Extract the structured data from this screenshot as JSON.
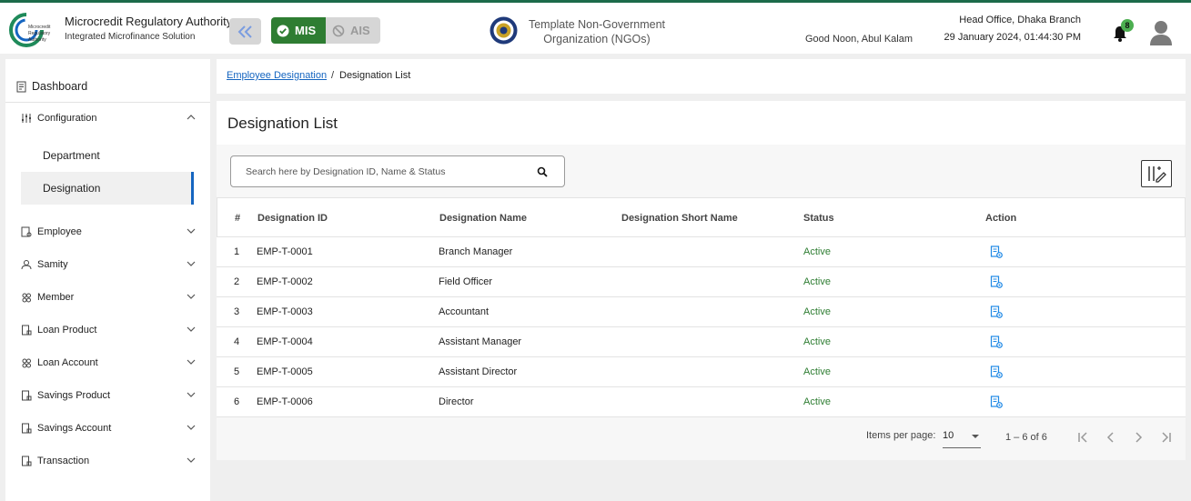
{
  "header": {
    "logo_text": "Microcredit Regulatory Authority",
    "brand_title": "Microcredit Regulatory Authority",
    "brand_subtitle": "Integrated Microfinance Solution",
    "mis_label": "MIS",
    "ais_label": "AIS",
    "org_line1": "Template Non-Government",
    "org_line2": "Organization (NGOs)",
    "greeting": "Good Noon, Abul Kalam",
    "branch": "Head Office, Dhaka Branch",
    "datetime": "29 January 2024, 01:44:30 PM",
    "notification_count": "8",
    "colors": {
      "brand_green": "#2e7d32",
      "accent_blue": "#1565c0"
    }
  },
  "sidebar": {
    "dashboard": "Dashboard",
    "items": [
      {
        "label": "Configuration",
        "icon": "sliders-icon",
        "expanded": true
      },
      {
        "label": "Employee",
        "icon": "employee-icon"
      },
      {
        "label": "Samity",
        "icon": "group-icon"
      },
      {
        "label": "Member",
        "icon": "members-icon"
      },
      {
        "label": "Loan Product",
        "icon": "document-icon"
      },
      {
        "label": "Loan Account",
        "icon": "members-icon"
      },
      {
        "label": "Savings Product",
        "icon": "document-icon"
      },
      {
        "label": "Savings Account",
        "icon": "document-icon"
      },
      {
        "label": "Transaction",
        "icon": "document-icon"
      }
    ],
    "sub_items": [
      {
        "label": "Department"
      },
      {
        "label": "Designation",
        "active": true
      }
    ]
  },
  "breadcrumb": {
    "link": "Employee Designation",
    "separator": "/",
    "current": "Designation List"
  },
  "main": {
    "title": "Designation List",
    "search_placeholder": "Search here by Designation ID, Name & Status"
  },
  "table": {
    "headers": [
      "#",
      "Designation ID",
      "Designation Name",
      "Designation Short Name",
      "Status",
      "Action"
    ],
    "rows": [
      {
        "num": "1",
        "id": "EMP-T-0001",
        "name": "Branch Manager",
        "short": "",
        "status": "Active"
      },
      {
        "num": "2",
        "id": "EMP-T-0002",
        "name": "Field Officer",
        "short": "",
        "status": "Active"
      },
      {
        "num": "3",
        "id": "EMP-T-0003",
        "name": "Accountant",
        "short": "",
        "status": "Active"
      },
      {
        "num": "4",
        "id": "EMP-T-0004",
        "name": "Assistant Manager",
        "short": "",
        "status": "Active"
      },
      {
        "num": "5",
        "id": "EMP-T-0005",
        "name": "Assistant Director",
        "short": "",
        "status": "Active"
      },
      {
        "num": "6",
        "id": "EMP-T-0006",
        "name": "Director",
        "short": "",
        "status": "Active"
      }
    ]
  },
  "pagination": {
    "items_per_page_label": "Items per page:",
    "items_per_page_value": "10",
    "range": "1 – 6 of 6"
  }
}
